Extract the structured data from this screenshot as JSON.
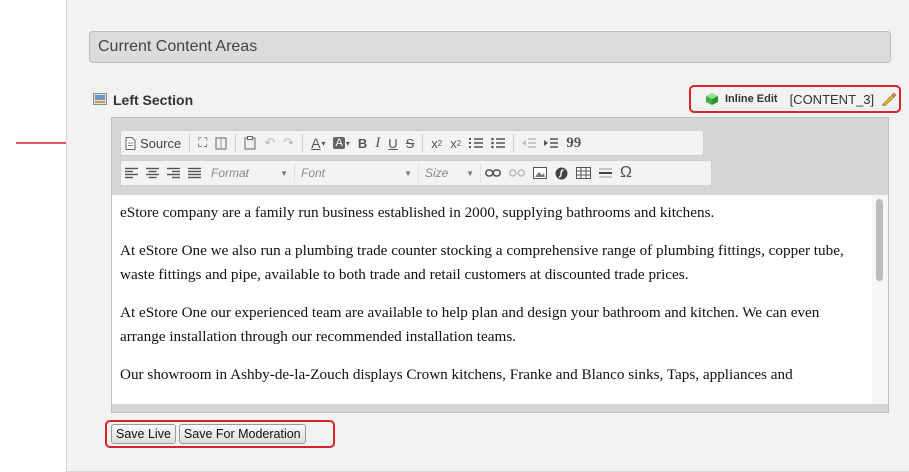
{
  "areas_bar": {
    "title": "Current Content Areas"
  },
  "section": {
    "title": "Left Section",
    "icon": "section-icon",
    "inline_edit": {
      "label": "Inline Edit",
      "code": "[CONTENT_3]",
      "icon": "cube-icon",
      "edit_icon": "pencil-icon"
    }
  },
  "toolbar": {
    "source_label": "Source",
    "format_label": "Format",
    "font_label": "Font",
    "size_label": "Size"
  },
  "content": {
    "paragraphs": [
      "eStore company are a family run business established in 2000, supplying bathrooms and kitchens.",
      "At eStore One we also run a plumbing trade counter stocking a comprehensive range of plumbing fittings, copper tube, waste fittings and pipe, available to both trade and retail customers at discounted trade prices.",
      "At eStore One our experienced team are available to help plan and design your bathroom and kitchen. We can even arrange installation through our recommended installation teams.",
      "Our showroom in Ashby-de-la-Zouch displays Crown kitchens, Franke and Blanco sinks, Taps, appliances and"
    ]
  },
  "buttons": {
    "save_live": "Save Live",
    "save_moderation": "Save For Moderation"
  },
  "colors": {
    "highlight": "#d9232a",
    "panel": "#f2f2f2",
    "editor_chrome": "#d6d6d6"
  }
}
